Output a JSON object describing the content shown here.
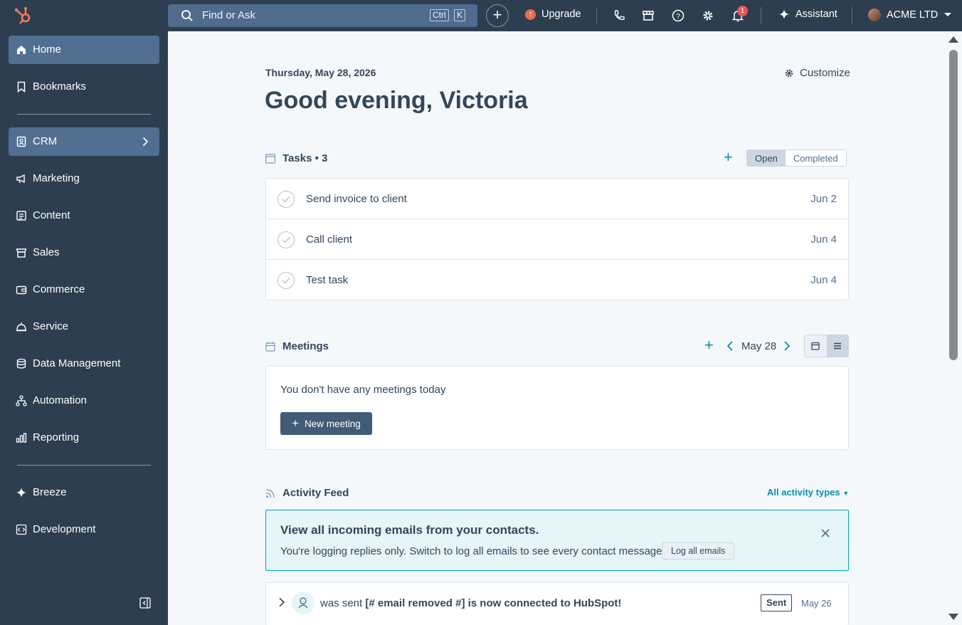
{
  "topbar": {
    "search_placeholder": "Find or Ask",
    "shortcut_ctrl": "Ctrl",
    "shortcut_key": "K",
    "create_label": "+",
    "upgrade_label": "Upgrade",
    "notifications_count": "1",
    "assistant_label": "Assistant",
    "account_name": "ACME LTD"
  },
  "sidebar": {
    "items": [
      {
        "label": "Home",
        "icon": "home-icon"
      },
      {
        "label": "Bookmarks",
        "icon": "bookmark-icon"
      },
      {
        "label": "CRM",
        "icon": "contacts-icon"
      },
      {
        "label": "Marketing",
        "icon": "megaphone-icon"
      },
      {
        "label": "Content",
        "icon": "content-icon"
      },
      {
        "label": "Sales",
        "icon": "sales-icon"
      },
      {
        "label": "Commerce",
        "icon": "wallet-icon"
      },
      {
        "label": "Service",
        "icon": "service-icon"
      },
      {
        "label": "Data Management",
        "icon": "database-icon"
      },
      {
        "label": "Automation",
        "icon": "automation-icon"
      },
      {
        "label": "Reporting",
        "icon": "reporting-icon"
      },
      {
        "label": "Breeze",
        "icon": "sparkle-icon"
      },
      {
        "label": "Development",
        "icon": "code-icon"
      }
    ]
  },
  "main": {
    "date": "Thursday, May 28, 2026",
    "customize_label": "Customize",
    "greeting": "Good evening, Victoria",
    "tasks": {
      "title": "Tasks • 3",
      "toggle_open": "Open",
      "toggle_completed": "Completed",
      "rows": [
        {
          "title": "Send invoice to client",
          "due": "Jun 2"
        },
        {
          "title": "Call client",
          "due": "Jun 4"
        },
        {
          "title": "Test task",
          "due": "Jun 4"
        }
      ]
    },
    "meetings": {
      "title": "Meetings",
      "current_date": "May 28",
      "empty_text": "You don't have any meetings today",
      "new_meeting_label": "New meeting"
    },
    "activity": {
      "title": "Activity Feed",
      "filter_label": "All activity types",
      "banner_title": "View all incoming emails from your contacts.",
      "banner_text": "You're logging replies only. Switch to log all emails to see every contact message.",
      "banner_button": "Log all emails",
      "feed_prefix": "was sent",
      "feed_subject": "[# email removed #] is now connected to HubSpot!",
      "feed_tag": "Sent",
      "feed_date": "May 26"
    }
  },
  "colors": {
    "nav_bg": "#2d3e50",
    "active_item": "#516f90",
    "accent_teal": "#0091ae",
    "page_bg": "#f5f8fa",
    "upgrade_orange": "#e66e50",
    "notification_red": "#f2545b"
  }
}
